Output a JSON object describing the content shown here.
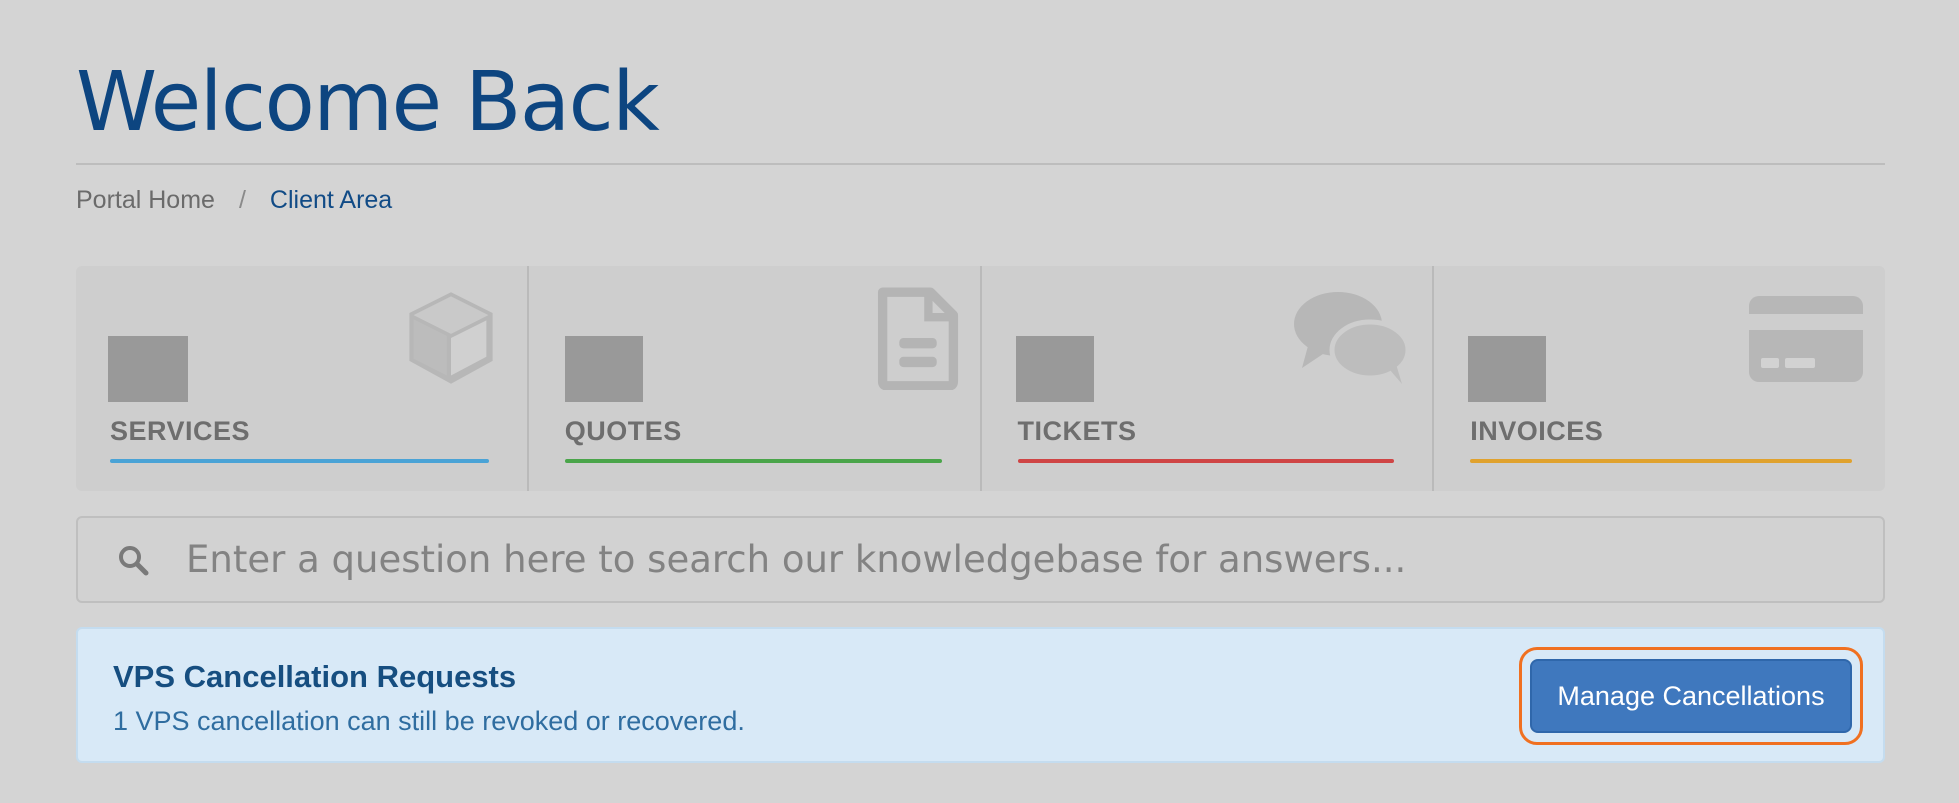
{
  "page": {
    "title": "Welcome Back"
  },
  "breadcrumb": {
    "items": [
      {
        "label": "Portal Home"
      },
      {
        "label": "Client Area"
      }
    ],
    "separator": "/"
  },
  "tiles": [
    {
      "label": "SERVICES",
      "icon": "cube-icon",
      "accent": "#4aa3d6"
    },
    {
      "label": "QUOTES",
      "icon": "document-icon",
      "accent": "#4aa54a"
    },
    {
      "label": "TICKETS",
      "icon": "chat-bubbles-icon",
      "accent": "#cf4545"
    },
    {
      "label": "INVOICES",
      "icon": "credit-card-icon",
      "accent": "#e0a22e"
    }
  ],
  "search": {
    "placeholder": "Enter a question here to search our knowledgebase for answers...",
    "icon": "search-icon"
  },
  "notice": {
    "title": "VPS Cancellation Requests",
    "text": "1 VPS cancellation can still be revoked or recovered.",
    "button_label": "Manage Cancellations"
  },
  "colors": {
    "title": "#0d4580",
    "button": "#3f78be",
    "highlight": "#f07020",
    "notice_bg": "#d8e9f7"
  }
}
